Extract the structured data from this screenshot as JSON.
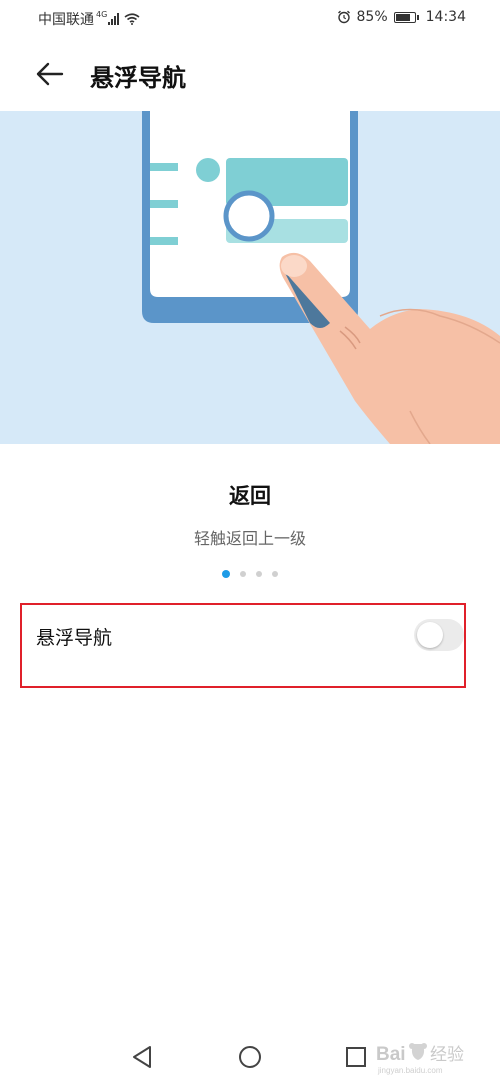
{
  "status_bar": {
    "carrier": "中国联通",
    "network_type": "4G",
    "battery_percent": "85%",
    "battery_level": 0.85,
    "time": "14:34",
    "icons": [
      "signal-icon",
      "wifi-icon",
      "alarm-icon",
      "battery-icon"
    ]
  },
  "header": {
    "title": "悬浮导航",
    "back_icon": "arrow-left-icon"
  },
  "carousel": {
    "slide_title": "返回",
    "slide_description": "轻触返回上一级",
    "page_count": 4,
    "active_page": 1
  },
  "setting": {
    "label": "悬浮导航",
    "enabled": false
  },
  "nav_bar": {
    "icons": [
      "nav-back-icon",
      "nav-home-icon",
      "nav-recents-icon"
    ]
  },
  "colors": {
    "illustration_bg": "#d6e9f8",
    "accent": "#1e9be6",
    "highlight_border": "#e0202a"
  },
  "watermark_logo": "Bai 经验 jingyan.baidu.com"
}
